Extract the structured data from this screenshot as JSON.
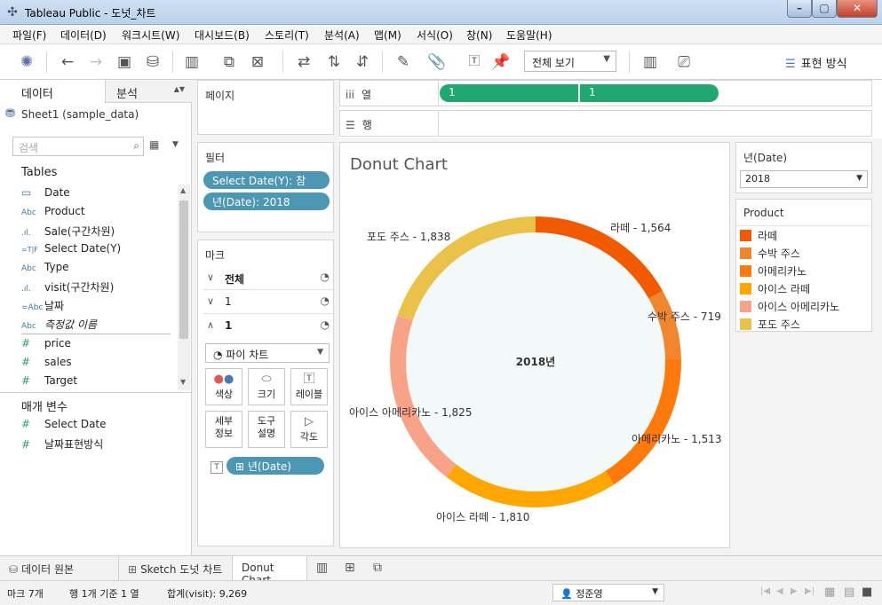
{
  "window": {
    "title": "Tableau Public - 도넛_차트"
  },
  "menu": [
    "파일(F)",
    "데이터(D)",
    "워크시트(W)",
    "대시보드(B)",
    "스토리(T)",
    "분석(A)",
    "맵(M)",
    "서식(O)",
    "창(N)",
    "도움말(H)"
  ],
  "toolbar": {
    "view_select": "전체 보기",
    "present_label": "표현 방식"
  },
  "datapane": {
    "tab_data": "데이터",
    "tab_analysis": "분석",
    "datasource": "Sheet1 (sample_data)",
    "search_placeholder": "검색",
    "tables_title": "Tables",
    "dimensions": [
      {
        "icon": "calendar-icon",
        "glyph": "📅",
        "type": "cal",
        "name": "Date"
      },
      {
        "icon": "abc-icon",
        "glyph": "Abc",
        "type": "",
        "name": "Product"
      },
      {
        "icon": "bin-icon",
        "glyph": ".ıl.",
        "type": "",
        "name": "Sale(구간차원)"
      },
      {
        "icon": "boolean-icon",
        "glyph": "=T|F",
        "type": "",
        "name": "Select Date(Y)"
      },
      {
        "icon": "abc-icon",
        "glyph": "Abc",
        "type": "",
        "name": "Type"
      },
      {
        "icon": "bin-icon",
        "glyph": ".ıl.",
        "type": "",
        "name": "visit(구간차원)"
      },
      {
        "icon": "calc-abc-icon",
        "glyph": "=Abc",
        "type": "",
        "name": "날짜"
      },
      {
        "icon": "abc-icon",
        "glyph": "Abc",
        "type": "",
        "name": "측정값 이름",
        "italic": true
      }
    ],
    "measures": [
      {
        "icon": "measure-icon",
        "glyph": "#",
        "name": "price"
      },
      {
        "icon": "measure-icon",
        "glyph": "#",
        "name": "sales"
      },
      {
        "icon": "measure-icon",
        "glyph": "#",
        "name": "Target"
      }
    ],
    "params_title": "매개 변수",
    "params": [
      {
        "icon": "param-icon",
        "glyph": "#",
        "name": "Select Date"
      },
      {
        "icon": "param-icon",
        "glyph": "#",
        "name": "날짜표현방식"
      }
    ]
  },
  "pages": {
    "title": "페이지"
  },
  "filters": {
    "title": "필터",
    "pills": [
      "Select Date(Y): 참",
      "년(Date): 2018"
    ]
  },
  "marks": {
    "title": "마크",
    "rows": [
      {
        "chev": "∨",
        "label": "전체",
        "bold": true
      },
      {
        "chev": "∨",
        "label": "1",
        "bold": false
      },
      {
        "chev": "∧",
        "label": "1",
        "bold": true
      }
    ],
    "mark_type": "파이 차트",
    "buttons": [
      {
        "icon": "color-icon",
        "glyph": "●",
        "label": "색상"
      },
      {
        "icon": "size-icon",
        "glyph": "◯",
        "label": "크기"
      },
      {
        "icon": "label-icon",
        "glyph": "T",
        "label": "레이블"
      },
      {
        "icon": "detail-icon",
        "glyph": "",
        "label": "세부\n정보"
      },
      {
        "icon": "tooltip-icon",
        "glyph": "",
        "label": "도구\n설명"
      },
      {
        "icon": "angle-icon",
        "glyph": "▷",
        "label": "각도"
      }
    ],
    "label_pill": "년(Date)"
  },
  "shelves": {
    "columns_label": "열",
    "rows_label": "행",
    "column_pills": [
      "1",
      "1"
    ]
  },
  "viz": {
    "title": "Donut Chart",
    "center_label": "2018년"
  },
  "chart_data": {
    "type": "pie",
    "title": "Donut Chart",
    "center_label": "2018년",
    "categories": [
      "라떼",
      "수박 주스",
      "아메리카노",
      "아이스 라떼",
      "아이스 아메리카노",
      "포도 주스"
    ],
    "values": [
      1564,
      719,
      1513,
      1810,
      1825,
      1838
    ],
    "colors": [
      "#f25a00",
      "#f0862e",
      "#ff7a0a",
      "#ffa600",
      "#f8a287",
      "#eac24a"
    ],
    "data_labels": [
      "라떼 - 1,564",
      "수박 주스 - 719",
      "아메리카노 - 1,513",
      "아이스 라떼 - 1,810",
      "아이스 아메리카노 - 1,825",
      "포도 주스 - 1,838"
    ]
  },
  "year_filter": {
    "title": "년(Date)",
    "value": "2018"
  },
  "legend": {
    "title": "Product",
    "items": [
      {
        "label": "라떼",
        "color": "#f25a00"
      },
      {
        "label": "수박 주스",
        "color": "#f0862e"
      },
      {
        "label": "아메리카노",
        "color": "#ff7a0a"
      },
      {
        "label": "아이스 라떼",
        "color": "#ffa600"
      },
      {
        "label": "아이스 아메리카노",
        "color": "#f8a287"
      },
      {
        "label": "포도 주스",
        "color": "#eac24a"
      }
    ]
  },
  "sheet_tabs": {
    "data_source": "데이터 원본",
    "sketch": "Sketch 도넛 차트",
    "active": "Donut Chart"
  },
  "status": {
    "marks": "마크 7개",
    "rows_cols": "행 1개 기준 1 열",
    "sum": "합계(visit): 9,269",
    "user": "정준영"
  }
}
